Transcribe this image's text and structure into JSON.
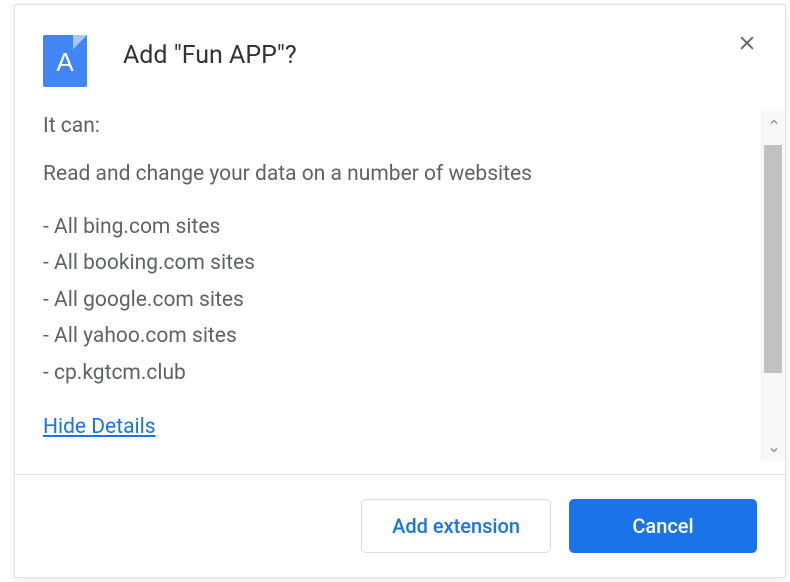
{
  "header": {
    "title": "Add \"Fun APP\"?",
    "icon_letter": "A"
  },
  "content": {
    "intro": "It can:",
    "permission_desc": "Read and change your data on a number of websites",
    "sites": [
      "All bing.com sites",
      "All booking.com sites",
      "All google.com sites",
      "All yahoo.com sites",
      "cp.kgtcm.club"
    ],
    "hide_details_label": "Hide Details"
  },
  "footer": {
    "add_label": "Add extension",
    "cancel_label": "Cancel"
  }
}
